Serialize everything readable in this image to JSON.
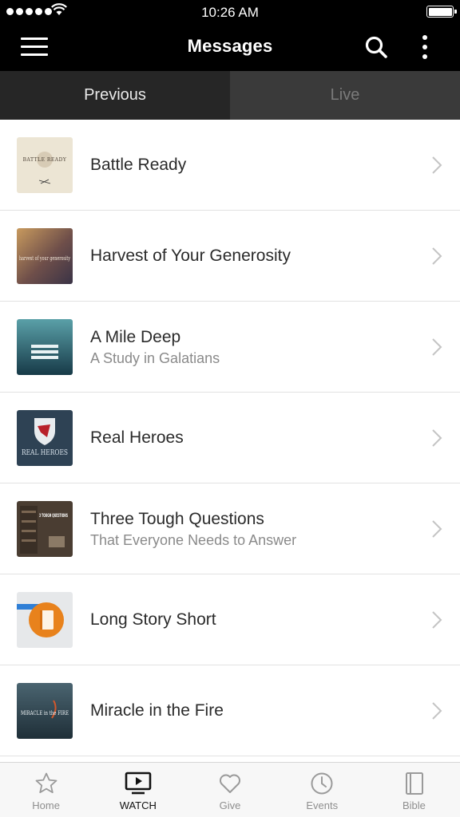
{
  "status_bar": {
    "time": "10:26 AM"
  },
  "header": {
    "title": "Messages"
  },
  "tabs": [
    {
      "label": "Previous",
      "active": true
    },
    {
      "label": "Live",
      "active": false
    }
  ],
  "messages": [
    {
      "title": "Battle Ready",
      "subtitle": "",
      "thumb_text": "BATTLE READY"
    },
    {
      "title": "Harvest of Your Generosity",
      "subtitle": "",
      "thumb_text": "harvest of your generosity"
    },
    {
      "title": "A Mile Deep",
      "subtitle": "A Study in Galatians",
      "thumb_text": "A MILE DEEP"
    },
    {
      "title": "Real Heroes",
      "subtitle": "",
      "thumb_text": "REAL HEROES"
    },
    {
      "title": "Three Tough Questions",
      "subtitle": "That Everyone Needs to Answer",
      "thumb_text": "3 TOUGH QUESTIONS"
    },
    {
      "title": "Long Story Short",
      "subtitle": "",
      "thumb_text": ""
    },
    {
      "title": "Miracle in the Fire",
      "subtitle": "",
      "thumb_text": "MIRACLE in the FIRE"
    }
  ],
  "tab_bar": [
    {
      "label": "Home",
      "icon": "star-icon",
      "active": false
    },
    {
      "label": "WATCH",
      "icon": "play-screen-icon",
      "active": true
    },
    {
      "label": "Give",
      "icon": "heart-icon",
      "active": false
    },
    {
      "label": "Events",
      "icon": "clock-icon",
      "active": false
    },
    {
      "label": "Bible",
      "icon": "book-icon",
      "active": false
    }
  ],
  "colors": {
    "header_bg": "#000000",
    "tab_active_bg": "#262626",
    "tab_inactive_bg": "#3a3a3a",
    "long_story_orange": "#e8821c",
    "long_story_tag": "#2f7fd6"
  }
}
